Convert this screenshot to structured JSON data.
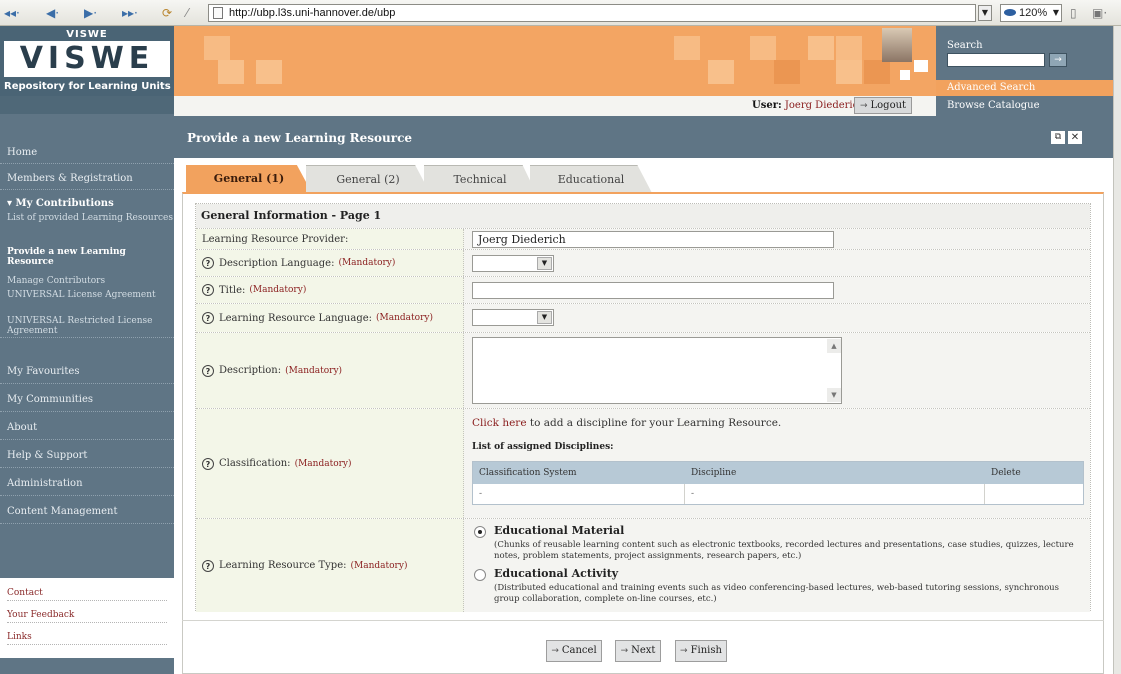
{
  "browser": {
    "url": "http://ubp.l3s.uni-hannover.de/ubp",
    "zoom": "120%"
  },
  "sidebar": {
    "logo_small": "VISWE",
    "logo_big": "VISWE",
    "tagline": "Repository for Learning Units",
    "items": [
      {
        "label": "Home"
      },
      {
        "label": "Members & Registration"
      },
      {
        "label": "▾ My Contributions"
      },
      {
        "label": "My Favourites"
      },
      {
        "label": "My Communities"
      },
      {
        "label": "About"
      },
      {
        "label": "Help & Support"
      },
      {
        "label": "Administration"
      },
      {
        "label": "Content Management"
      }
    ],
    "sub_items": [
      {
        "label": "List of provided Learning Resources"
      },
      {
        "label": "Provide a new Learning Resource"
      },
      {
        "label": "Manage Contributors"
      },
      {
        "label": "UNIVERSAL License Agreement"
      },
      {
        "label": "UNIVERSAL Restricted License Agreement"
      }
    ],
    "footer_links": [
      {
        "label": "Contact"
      },
      {
        "label": "Your Feedback"
      },
      {
        "label": "Links"
      }
    ]
  },
  "header": {
    "search_label": "Search",
    "search_go": "→",
    "advanced_search": "Advanced Search",
    "browse_catalogue": "Browse Catalogue",
    "user_label": "User:",
    "user_name": "Joerg Diederich",
    "logout": "Logout"
  },
  "page": {
    "title": "Provide a new Learning Resource",
    "tabs": [
      {
        "label": "General (1)",
        "active": true
      },
      {
        "label": "General (2)",
        "active": false
      },
      {
        "label": "Technical",
        "active": false
      },
      {
        "label": "Educational",
        "active": false
      }
    ]
  },
  "form": {
    "section_title": "General Information - Page 1",
    "mandatory": "(Mandatory)",
    "provider_label": "Learning Resource Provider:",
    "provider_value": "Joerg Diederich",
    "desc_language_label": "Description Language:",
    "title_label": "Title:",
    "lr_language_label": "Learning Resource Language:",
    "description_label": "Description:",
    "classification_label": "Classification:",
    "click_here": "Click here",
    "click_here_rest": " to add a discipline for your Learning Resource.",
    "list_title": "List of assigned Disciplines:",
    "table_headers": [
      "Classification System",
      "Discipline",
      "Delete"
    ],
    "table_row": [
      "-",
      "-",
      ""
    ],
    "resource_type_label": "Learning Resource Type:",
    "types": [
      {
        "title": "Educational Material",
        "selected": true,
        "desc": "(Chunks of reusable learning content such as electronic textbooks, recorded lectures and presentations, case studies, quizzes, lecture notes, problem statements, project assignments, research papers, etc.)"
      },
      {
        "title": "Educational Activity",
        "selected": false,
        "desc": "(Distributed educational and training events such as video conferencing-based lectures, web-based tutoring sessions, synchronous group collaboration, complete on-line courses, etc.)"
      }
    ]
  },
  "buttons": {
    "cancel": "Cancel",
    "next": "Next",
    "finish": "Finish"
  }
}
